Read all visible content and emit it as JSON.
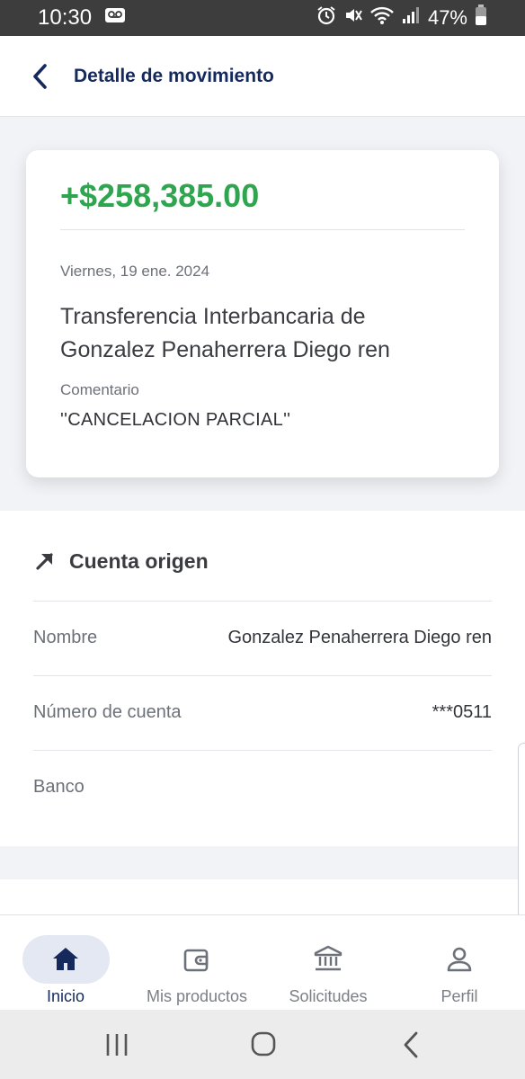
{
  "status_bar": {
    "time": "10:30",
    "battery": "47%",
    "icons": [
      "voicemail-icon",
      "alarm-icon",
      "mute-icon",
      "wifi-icon",
      "signal-icon",
      "battery-icon"
    ]
  },
  "header": {
    "title": "Detalle de movimiento",
    "back_icon": "chevron-left-icon"
  },
  "summary": {
    "amount": "+$258,385.00",
    "date": "Viernes, 19 ene. 2024",
    "description": "Transferencia Interbancaria de Gonzalez Penaherrera Diego ren",
    "comment_label": "Comentario",
    "comment_value": "''CANCELACION PARCIAL''"
  },
  "origin_account": {
    "title": "Cuenta origen",
    "icon": "arrow-up-right-icon",
    "rows": [
      {
        "label": "Nombre",
        "value": "Gonzalez Penaherrera Diego ren"
      },
      {
        "label": "Número de cuenta",
        "value": "***0511"
      },
      {
        "label": "Banco",
        "value": ""
      }
    ]
  },
  "bottom_nav": {
    "items": [
      {
        "label": "Inicio",
        "icon": "home-icon",
        "active": true
      },
      {
        "label": "Mis productos",
        "icon": "wallet-icon",
        "active": false
      },
      {
        "label": "Solicitudes",
        "icon": "bank-icon",
        "active": false
      },
      {
        "label": "Perfil",
        "icon": "user-icon",
        "active": false
      }
    ]
  },
  "colors": {
    "amount_green": "#2fa54f",
    "brand_navy": "#15295c",
    "active_pill": "#e4e8f2"
  }
}
